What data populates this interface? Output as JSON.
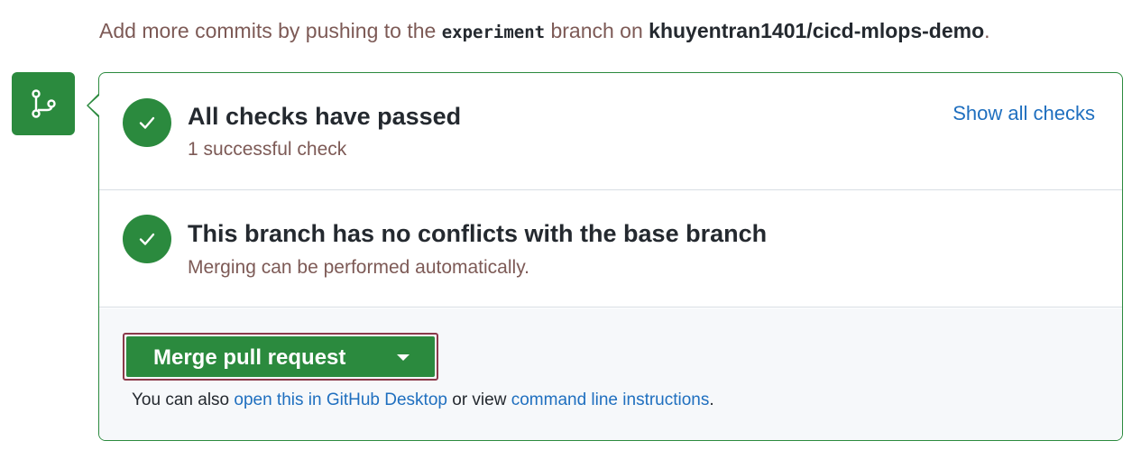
{
  "hint": {
    "prefix": "Add more commits by pushing to the ",
    "branch": "experiment",
    "middle": " branch on ",
    "repo": "khuyentran1401/cicd-mlops-demo",
    "suffix": "."
  },
  "checks": {
    "title": "All checks have passed",
    "subtitle": "1 successful check",
    "show_all_label": "Show all checks"
  },
  "conflicts": {
    "title": "This branch has no conflicts with the base branch",
    "subtitle": "Merging can be performed automatically."
  },
  "merge": {
    "button_label": "Merge pull request",
    "also_prefix": "You can also ",
    "desktop_link": "open this in GitHub Desktop",
    "also_middle": " or view ",
    "cli_link": "command line instructions",
    "also_suffix": "."
  },
  "colors": {
    "accent_green": "#2b8a3e",
    "link_blue": "#1f6fbf",
    "muted_text": "#7d5a56",
    "merge_outline": "#8b3a4a"
  },
  "icons": {
    "side": "git-branch-icon",
    "status": "check-icon",
    "dropdown": "caret-down-icon"
  }
}
